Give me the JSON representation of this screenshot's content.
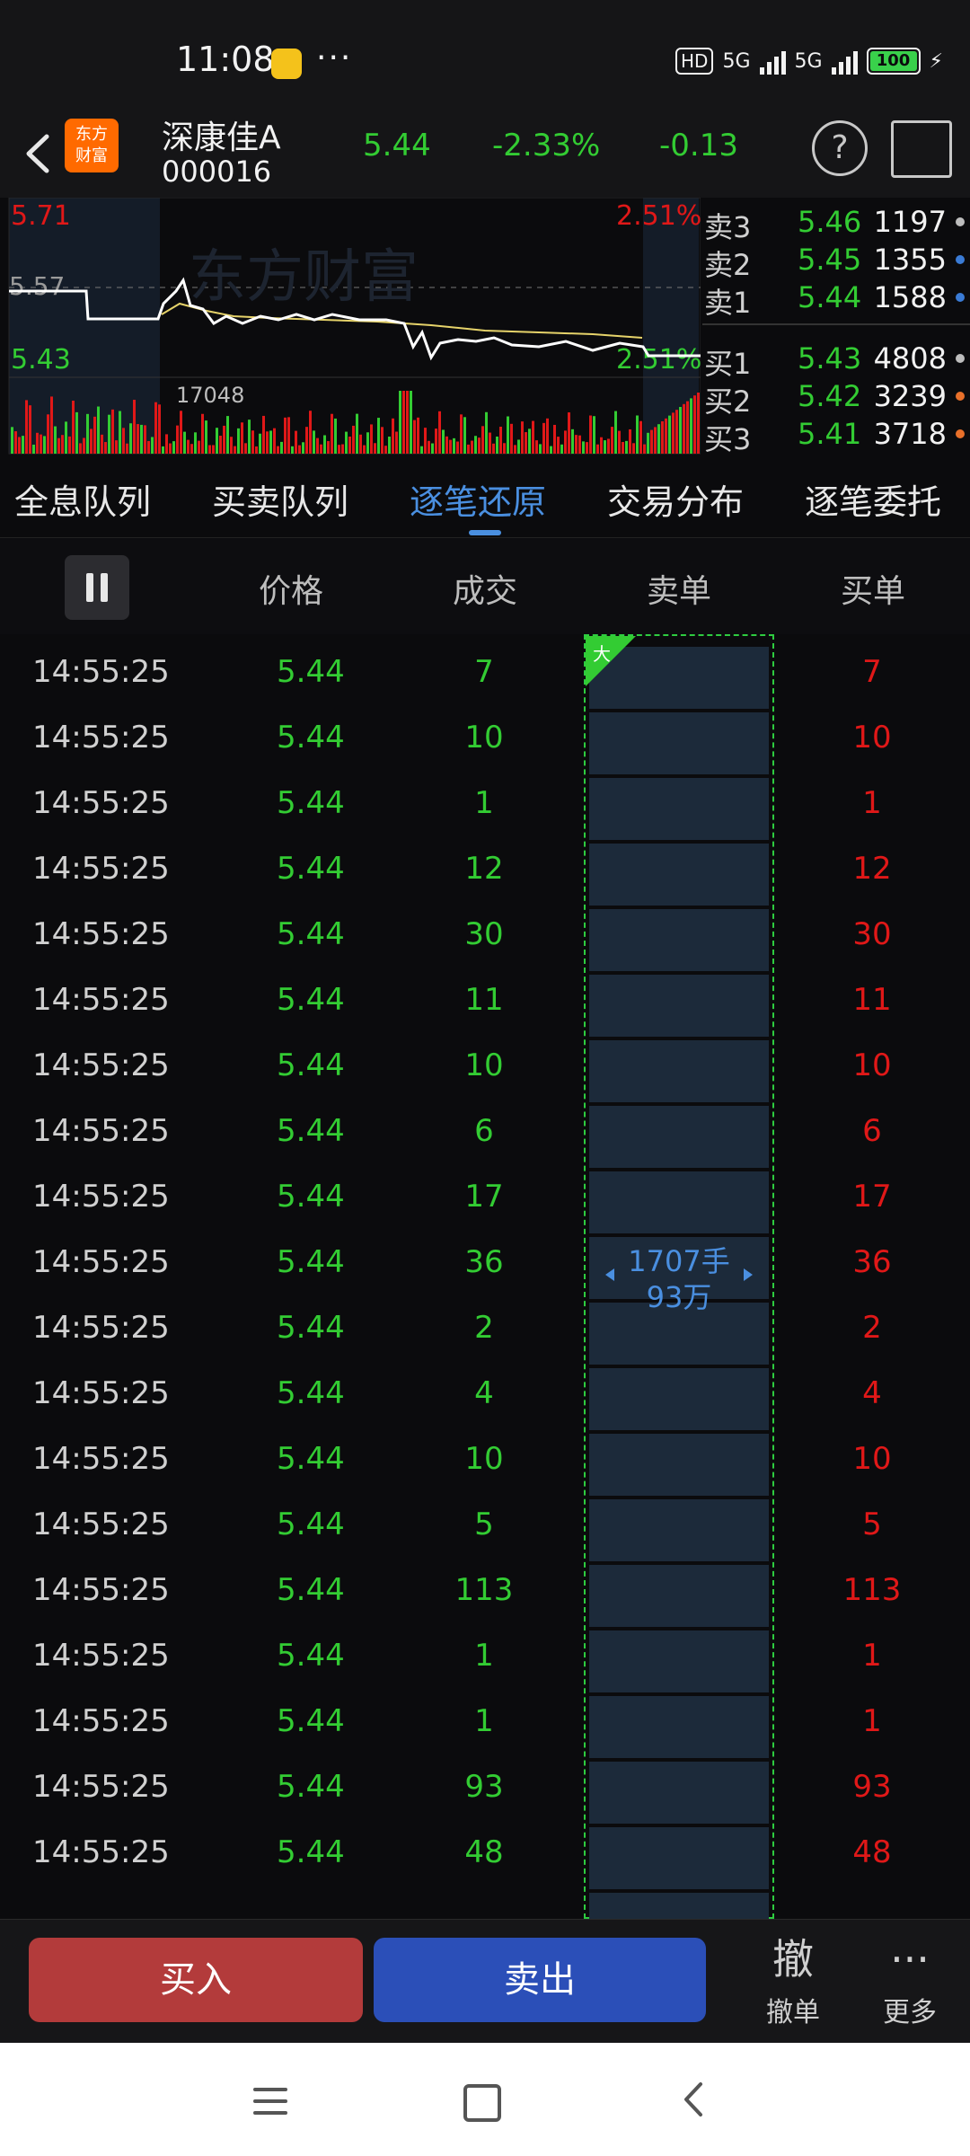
{
  "status_bar": {
    "time": "11:08",
    "dots": "···",
    "hd": "HD",
    "net1": "5G",
    "net2": "5G",
    "battery": "100"
  },
  "header": {
    "back": "back",
    "logo_text": [
      "东方",
      "财富"
    ],
    "name": "深康佳A",
    "code": "000016",
    "price": "5.44",
    "pct": "-2.33%",
    "change": "-0.13",
    "help": "?"
  },
  "chart": {
    "y_high": "5.71",
    "y_mid": "5.57",
    "y_low": "5.43",
    "pct_high": "2.51%",
    "pct_low": "2.51%",
    "vol_max": "17048",
    "watermark": "东方财富"
  },
  "order_book": {
    "asks": [
      {
        "label": "卖3",
        "price": "5.46",
        "vol": "1197",
        "dot": "#bdbdbd"
      },
      {
        "label": "卖2",
        "price": "5.45",
        "vol": "1355",
        "dot": "#3a7bd5"
      },
      {
        "label": "卖1",
        "price": "5.44",
        "vol": "1588",
        "dot": "#3a7bd5"
      }
    ],
    "bids": [
      {
        "label": "买1",
        "price": "5.43",
        "vol": "4808",
        "dot": "#bdbdbd"
      },
      {
        "label": "买2",
        "price": "5.42",
        "vol": "3239",
        "dot": "#e8702a"
      },
      {
        "label": "买3",
        "price": "5.41",
        "vol": "3718",
        "dot": "#e8702a"
      }
    ]
  },
  "tabs": [
    "全息队列",
    "买卖队列",
    "逐笔还原",
    "交易分布",
    "逐笔委托"
  ],
  "active_tab": 2,
  "columns": {
    "price": "价格",
    "volume": "成交",
    "sell": "卖单",
    "buy": "买单"
  },
  "rows": [
    {
      "time": "14:55:25",
      "price": "5.44",
      "vol": "7",
      "buy": "7"
    },
    {
      "time": "14:55:25",
      "price": "5.44",
      "vol": "10",
      "buy": "10"
    },
    {
      "time": "14:55:25",
      "price": "5.44",
      "vol": "1",
      "buy": "1"
    },
    {
      "time": "14:55:25",
      "price": "5.44",
      "vol": "12",
      "buy": "12"
    },
    {
      "time": "14:55:25",
      "price": "5.44",
      "vol": "30",
      "buy": "30"
    },
    {
      "time": "14:55:25",
      "price": "5.44",
      "vol": "11",
      "buy": "11"
    },
    {
      "time": "14:55:25",
      "price": "5.44",
      "vol": "10",
      "buy": "10"
    },
    {
      "time": "14:55:25",
      "price": "5.44",
      "vol": "6",
      "buy": "6"
    },
    {
      "time": "14:55:25",
      "price": "5.44",
      "vol": "17",
      "buy": "17"
    },
    {
      "time": "14:55:25",
      "price": "5.44",
      "vol": "36",
      "buy": "36"
    },
    {
      "time": "14:55:25",
      "price": "5.44",
      "vol": "2",
      "buy": "2"
    },
    {
      "time": "14:55:25",
      "price": "5.44",
      "vol": "4",
      "buy": "4"
    },
    {
      "time": "14:55:25",
      "price": "5.44",
      "vol": "10",
      "buy": "10"
    },
    {
      "time": "14:55:25",
      "price": "5.44",
      "vol": "5",
      "buy": "5"
    },
    {
      "time": "14:55:25",
      "price": "5.44",
      "vol": "113",
      "buy": "113"
    },
    {
      "time": "14:55:25",
      "price": "5.44",
      "vol": "1",
      "buy": "1"
    },
    {
      "time": "14:55:25",
      "price": "5.44",
      "vol": "1",
      "buy": "1"
    },
    {
      "time": "14:55:25",
      "price": "5.44",
      "vol": "93",
      "buy": "93"
    },
    {
      "time": "14:55:25",
      "price": "5.44",
      "vol": "48",
      "buy": "48"
    }
  ],
  "sell_order": {
    "big_label": "大",
    "hands": "1707手",
    "amount": "93万"
  },
  "actions": {
    "buy": "买入",
    "sell": "卖出",
    "cancel_glyph": "撤",
    "cancel": "撤单",
    "more_glyph": "···",
    "more": "更多"
  },
  "colors": {
    "up": "#e01818",
    "down": "#33cc33",
    "accent": "#4a8fe0",
    "buy_btn": "#b33b3b",
    "sell_btn": "#2b4fb8"
  }
}
